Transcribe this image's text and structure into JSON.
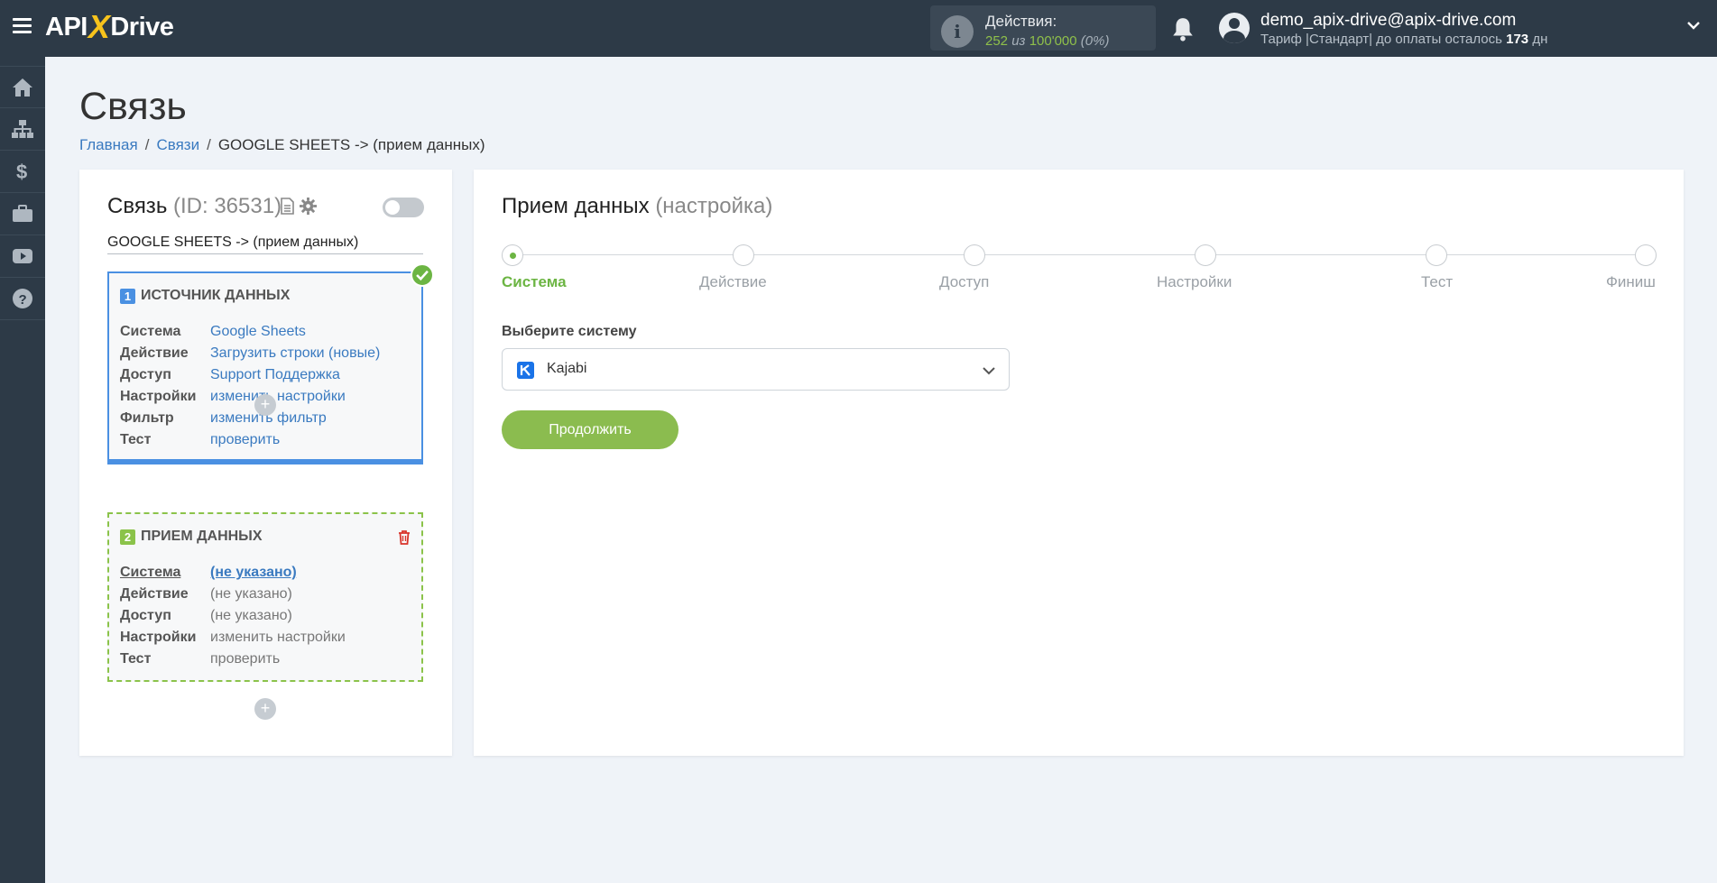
{
  "header": {
    "logo_a": "API",
    "logo_x": "X",
    "logo_b": "Drive",
    "actions_label": "Действия:",
    "actions_used": "252",
    "actions_of": "из",
    "actions_total": "100'000",
    "actions_pct": "(0%)",
    "user_email": "demo_apix-drive@apix-drive.com",
    "plan_prefix": "Тариф |Стандарт| до оплаты осталось",
    "plan_days": "173",
    "plan_suffix": "дн"
  },
  "sidebar": {
    "items": [
      "home-icon",
      "sitemap-icon",
      "dollar-icon",
      "briefcase-icon",
      "youtube-icon",
      "help-icon"
    ]
  },
  "page": {
    "title": "Связь",
    "breadcrumb": [
      "Главная",
      "Связи",
      "GOOGLE SHEETS -> (прием данных)"
    ]
  },
  "connection": {
    "title": "Связь",
    "id_text": "(ID: 36531)",
    "name": "GOOGLE SHEETS -> (прием данных)",
    "enabled": false
  },
  "source": {
    "num": "1",
    "title": "ИСТОЧНИК ДАННЫХ",
    "rows": [
      {
        "k": "Система",
        "v": "Google Sheets"
      },
      {
        "k": "Действие",
        "v": "Загрузить строки (новые)"
      },
      {
        "k": "Доступ",
        "v": "Support Поддержка"
      },
      {
        "k": "Настройки",
        "v": "изменить настройки"
      },
      {
        "k": "Фильтр",
        "v": "изменить фильтр"
      },
      {
        "k": "Тест",
        "v": "проверить"
      }
    ]
  },
  "destination": {
    "num": "2",
    "title": "ПРИЕМ ДАННЫХ",
    "rows": [
      {
        "k": "Система",
        "v": "(не указано)"
      },
      {
        "k": "Действие",
        "v": "(не указано)"
      },
      {
        "k": "Доступ",
        "v": "(не указано)"
      },
      {
        "k": "Настройки",
        "v": "изменить настройки"
      },
      {
        "k": "Тест",
        "v": "проверить"
      }
    ]
  },
  "plus_label": "+",
  "setup": {
    "title": "Прием данных",
    "subtitle": "(настройка)",
    "steps": [
      "Система",
      "Действие",
      "Доступ",
      "Настройки",
      "Тест",
      "Финиш"
    ],
    "active_step": 0,
    "select_label": "Выберите систему",
    "selected_system": "Kajabi",
    "continue_label": "Продолжить"
  },
  "colors": {
    "topbar": "#2d3a47",
    "accent_green": "#8bbc4f",
    "link_blue": "#3a7ac0",
    "source_border": "#4a90e2",
    "dest_border": "#8bc34a"
  }
}
